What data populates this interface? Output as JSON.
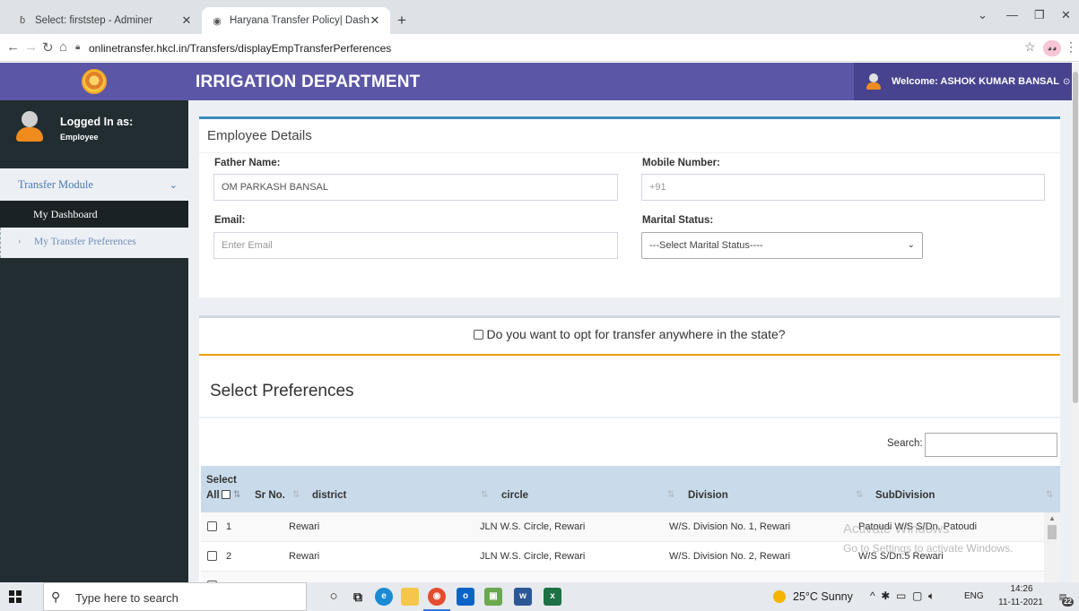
{
  "browser": {
    "tabs": [
      {
        "title": "Select: firststep - Adminer",
        "favicon": "adminer-icon"
      },
      {
        "title": "Haryana Transfer Policy| Dashboa",
        "favicon": "globe-icon"
      }
    ],
    "new_tab": "+",
    "url": "onlinetransfer.hkcl.in/Transfers/displayEmpTransferPerferences"
  },
  "header": {
    "title": "IRRIGATION DEPARTMENT",
    "welcome": "Welcome: ASHOK KUMAR BANSAL"
  },
  "sidebar": {
    "logged_in_label": "Logged In as:",
    "role": "Employee",
    "module": "Transfer Module",
    "items": [
      {
        "label": "My Dashboard"
      },
      {
        "label": "My Transfer Preferences"
      }
    ]
  },
  "employee_details": {
    "title": "Employee Details",
    "father_label": "Father Name:",
    "father_value": "OM PARKASH BANSAL",
    "mobile_label": "Mobile Number:",
    "mobile_placeholder": "+91",
    "email_label": "Email:",
    "email_placeholder": "Enter Email",
    "marital_label": "Marital Status:",
    "marital_selected": "---Select Marital Status----"
  },
  "preferences": {
    "opt_anywhere": "Do you want to opt for transfer anywhere in the state?",
    "title": "Select Preferences",
    "search_label": "Search:",
    "columns": {
      "select": "Select",
      "all": "All",
      "sr_no": "Sr No.",
      "district": "district",
      "circle": "circle",
      "division": "Division",
      "subdivision": "SubDivision"
    },
    "rows": [
      {
        "sr": "1",
        "district": "Rewari",
        "circle": "JLN W.S. Circle, Rewari",
        "division": "W/S. Division No. 1, Rewari",
        "subdivision": "Patoudi W/S S/Dn. Patoudi"
      },
      {
        "sr": "2",
        "district": "Rewari",
        "circle": "JLN W.S. Circle, Rewari",
        "division": "W/S. Division No. 2, Rewari",
        "subdivision": "W/S S/Dn.5 Rewari"
      }
    ]
  },
  "watermark": {
    "line1": "Activate Windows",
    "line2": "Go to Settings to activate Windows."
  },
  "taskbar": {
    "search_placeholder": "Type here to search",
    "weather": "25°C  Sunny",
    "lang": "ENG",
    "time": "14:26",
    "date": "11-11-2021",
    "notifications": "22"
  },
  "colors": {
    "header_purple": "#5b57a6",
    "sidebar_dark": "#222d32",
    "box_accent_blue": "#3c8dbc",
    "accent_orange": "#f39c12",
    "table_head": "#c9dbea"
  }
}
